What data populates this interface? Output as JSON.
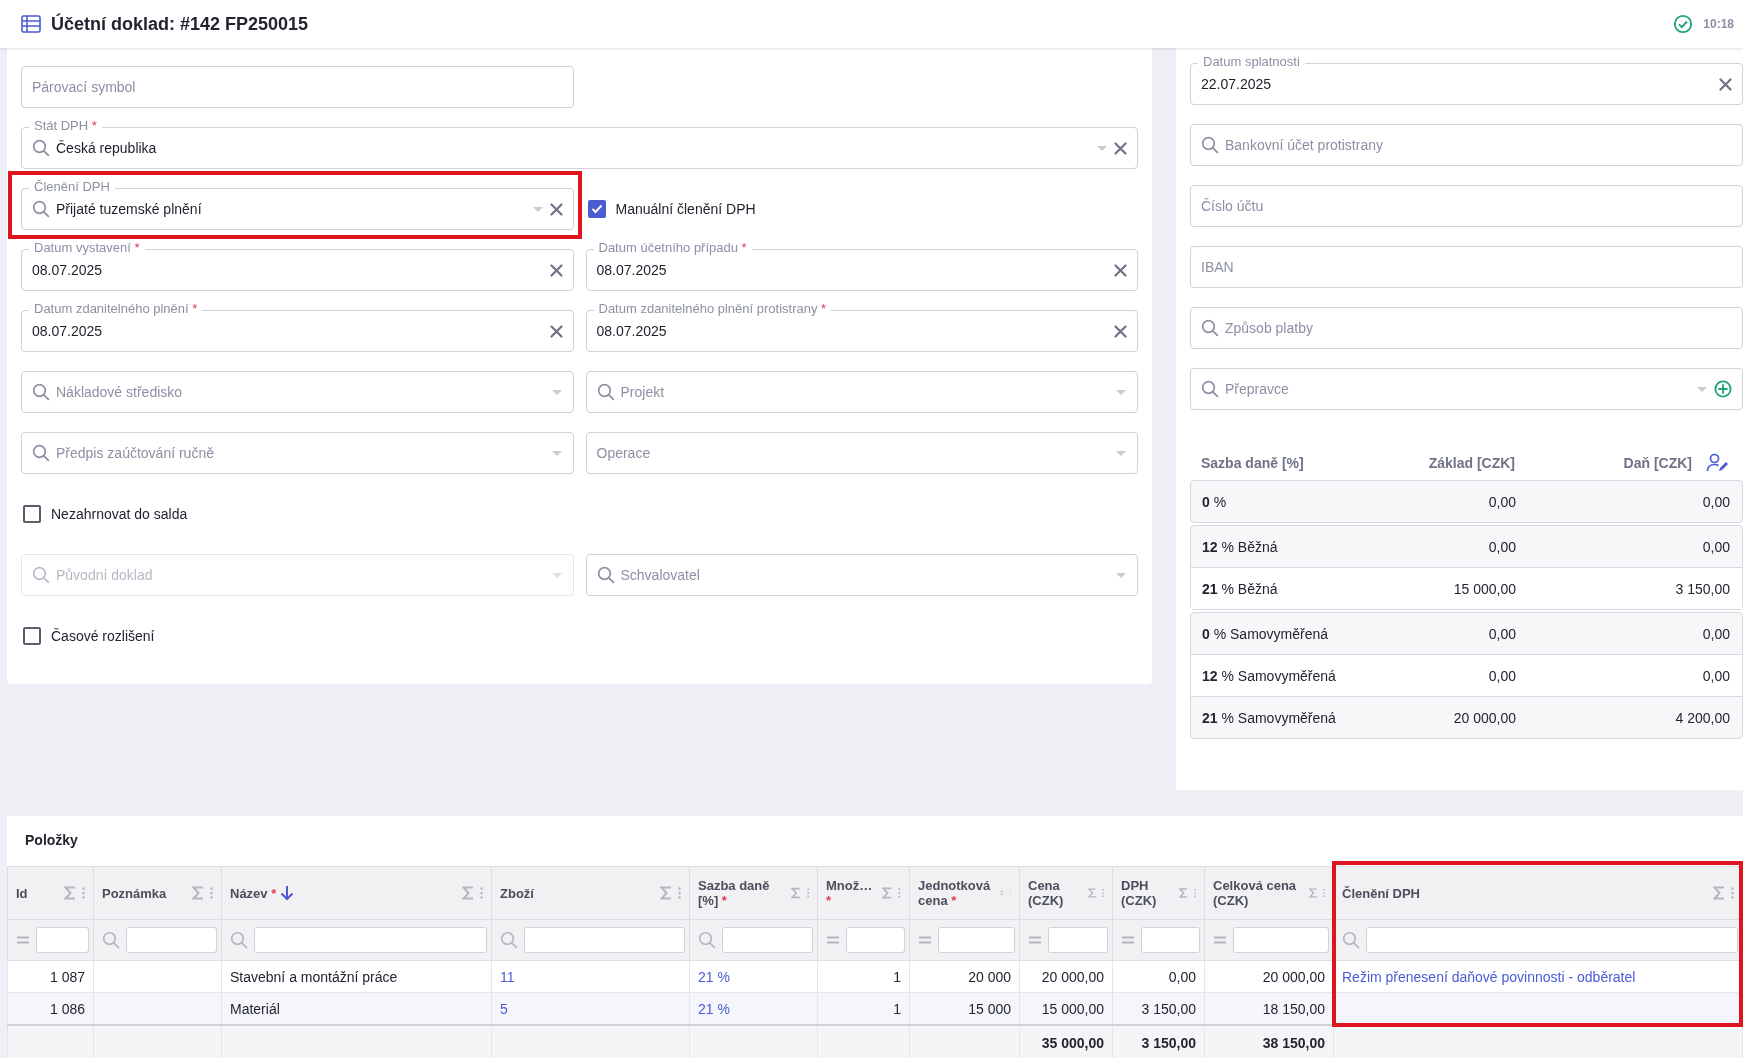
{
  "header": {
    "title": "Účetní doklad: #142 FP250015",
    "time": "10:18"
  },
  "form": {
    "rows": [
      {
        "kind": "normal",
        "items": [
          {
            "kind": "text",
            "placeholder": "Párovací symbol",
            "disabled": false
          }
        ]
      },
      {
        "kind": "wide",
        "items": [
          {
            "kind": "lookup-clear",
            "label": "Stát DPH",
            "required": "*",
            "value": "Česká republika",
            "disabled": false
          }
        ]
      },
      {
        "kind": "normal",
        "items": [
          {
            "kind": "lookup-clear",
            "label": "Členění DPH",
            "value": "Přijaté tuzemské plnění",
            "disabled": false,
            "highlighted": true
          },
          {
            "kind": "checkbox",
            "label": "Manuální členění DPH",
            "checked": true
          }
        ]
      },
      {
        "kind": "normal",
        "items": [
          {
            "kind": "date",
            "label": "Datum vystavení",
            "required": "*",
            "value": "08.07.2025",
            "disabled": false
          },
          {
            "kind": "date",
            "label": "Datum účetního případu",
            "required": "*",
            "value": "08.07.2025",
            "disabled": false
          }
        ]
      },
      {
        "kind": "normal",
        "items": [
          {
            "kind": "date",
            "label": "Datum zdanitelného plnění",
            "required": "*",
            "value": "08.07.2025",
            "disabled": false
          },
          {
            "kind": "date",
            "label": "Datum zdanitelného plnění protistrany",
            "required": "*",
            "value": "08.07.2025",
            "disabled": false
          }
        ]
      },
      {
        "kind": "normal",
        "items": [
          {
            "kind": "lookup",
            "placeholder": "Nákladové středisko",
            "disabled": false
          },
          {
            "kind": "lookup",
            "placeholder": "Projekt",
            "disabled": false
          }
        ]
      },
      {
        "kind": "normal",
        "items": [
          {
            "kind": "lookup",
            "placeholder": "Předpis zaúčtování ručně",
            "disabled": false
          },
          {
            "kind": "select",
            "placeholder": "Operace",
            "disabled": false
          }
        ]
      },
      {
        "kind": "normal",
        "items": [
          {
            "kind": "checkbox",
            "label": "Nezahrnovat do salda",
            "checked": false
          }
        ]
      },
      {
        "kind": "normal",
        "items": [
          {
            "kind": "lookup",
            "placeholder": "Původní doklad",
            "disabled": true
          },
          {
            "kind": "lookup",
            "placeholder": "Schvalovatel",
            "disabled": false
          }
        ]
      },
      {
        "kind": "normal",
        "items": [
          {
            "kind": "checkbox",
            "label": "Časové rozlišení",
            "checked": false
          }
        ]
      }
    ]
  },
  "side": {
    "fields": [
      {
        "kind": "date",
        "label": "Datum splatnosti",
        "value": "22.07.2025",
        "disabled": false
      },
      {
        "kind": "search",
        "placeholder": "Bankovní účet protistrany",
        "disabled": false
      },
      {
        "kind": "text",
        "placeholder": "Číslo účtu",
        "disabled": false
      },
      {
        "kind": "text",
        "placeholder": "IBAN",
        "disabled": false
      },
      {
        "kind": "search",
        "placeholder": "Způsob platby",
        "disabled": false
      },
      {
        "kind": "lookup-add",
        "placeholder": "Přepravce",
        "disabled": false
      }
    ],
    "tax": {
      "columns": [
        "Sazba daně [%]",
        "Základ [CZK]",
        "Daň [CZK]"
      ],
      "groups": [
        [
          {
            "rate": "**0** %",
            "base": "0,00",
            "tax": "0,00"
          }
        ],
        [
          {
            "rate": "**12** % Běžná",
            "base": "0,00",
            "tax": "0,00"
          },
          {
            "rate": "**21** % Běžná",
            "base": "15 000,00",
            "tax": "3 150,00"
          }
        ],
        [
          {
            "rate": "**0** % Samovyměřená",
            "base": "0,00",
            "tax": "0,00"
          },
          {
            "rate": "**12** % Samovyměřená",
            "base": "0,00",
            "tax": "0,00"
          },
          {
            "rate": "**21** % Samovyměřená",
            "base": "20 000,00",
            "tax": "4 200,00"
          }
        ]
      ]
    }
  },
  "items": {
    "title": "Položky",
    "columns": [
      {
        "label": "Id",
        "kind": "number",
        "sorted": false,
        "values": [
          "1 087",
          "1 086"
        ]
      },
      {
        "label": "Poznámka",
        "kind": "text",
        "sorted": false
      },
      {
        "label": "Název",
        "required": "*",
        "kind": "text",
        "sorted": true,
        "values": [
          "Stavební a montážní práce",
          "Materiál"
        ]
      },
      {
        "label": "Zboží",
        "kind": "link",
        "sorted": false,
        "values": [
          "11",
          "5"
        ]
      },
      {
        "label": "Sazba daně [%]",
        "required": "*",
        "kind": "link",
        "sorted": false,
        "values": [
          "21 %",
          "21 %"
        ]
      },
      {
        "label": "Množ…",
        "required": "*",
        "kind": "number",
        "sorted": false,
        "values": [
          "1",
          "1"
        ]
      },
      {
        "label": "Jednotková cena",
        "required": "*",
        "kind": "number",
        "sorted": false,
        "values": [
          "20 000",
          "15 000"
        ]
      },
      {
        "label": "Cena (CZK)",
        "kind": "number",
        "sorted": false,
        "values": [
          "20 000,00",
          "15 000,00"
        ],
        "total": "35 000,00"
      },
      {
        "label": "DPH (CZK)",
        "kind": "number",
        "sorted": false,
        "values": [
          "0,00",
          "3 150,00"
        ],
        "total": "3 150,00"
      },
      {
        "label": "Celková cena (CZK)",
        "kind": "number",
        "sorted": false,
        "values": [
          "20 000,00",
          "18 150,00"
        ],
        "total": "38 150,00"
      },
      {
        "label": "Členění DPH",
        "kind": "link",
        "sorted": false,
        "highlighted": true,
        "values": [
          "Režim přenesení daňové povinnosti - odběratel"
        ]
      }
    ]
  }
}
